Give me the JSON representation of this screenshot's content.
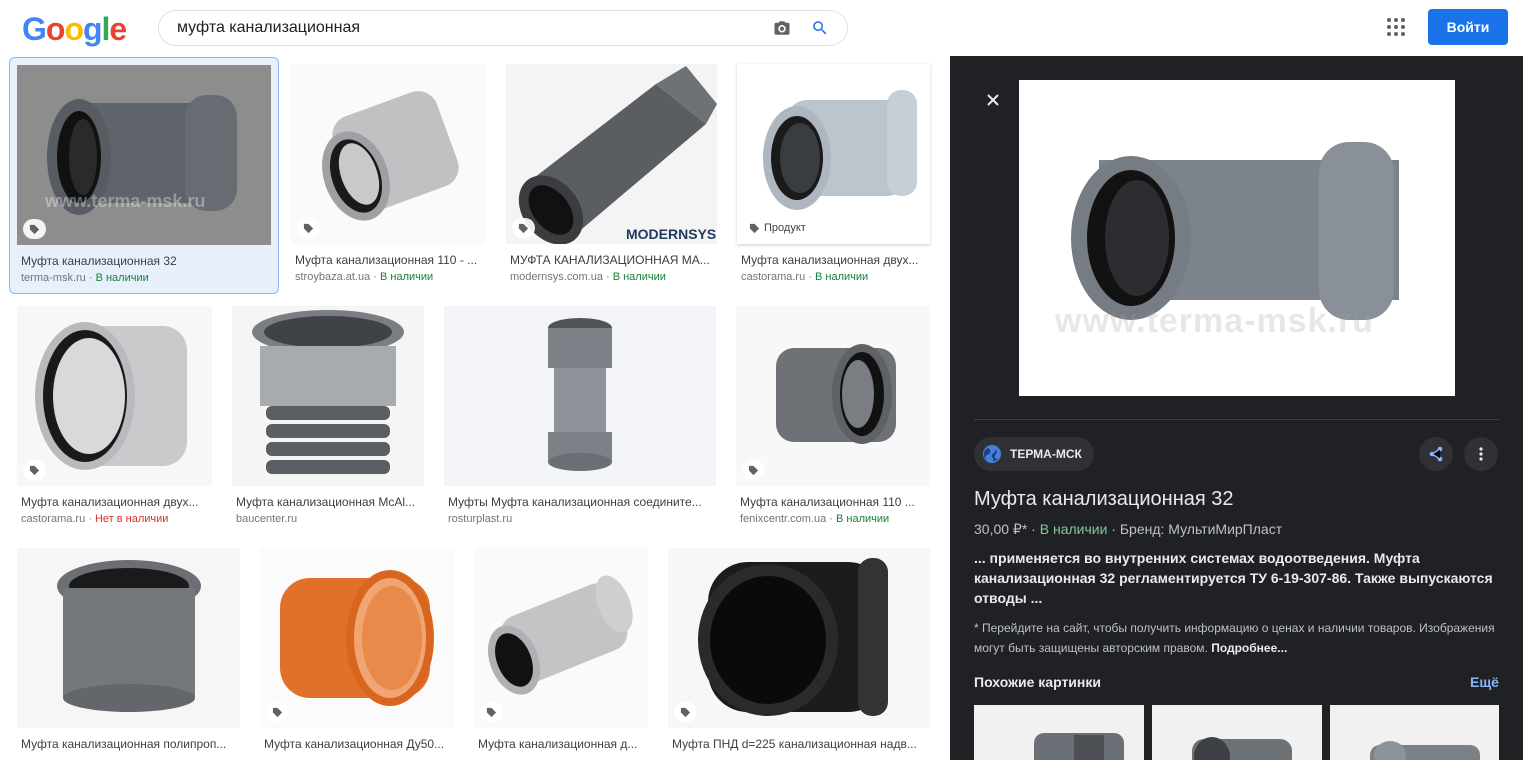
{
  "header": {
    "search_value": "муфта канализационная",
    "signin_label": "Войти"
  },
  "results": [
    {
      "title": "Муфта канализационная 32",
      "source": "terma-msk.ru",
      "status": "В наличии",
      "status_type": "available",
      "tag": "",
      "watermark": "www.terma-msk.ru"
    },
    {
      "title": "Муфта канализационная 110 - ...",
      "source": "stroybaza.at.ua",
      "status": "В наличии",
      "status_type": "available",
      "tag": ""
    },
    {
      "title": "МУФТА КАНАЛИЗАЦИОННАЯ МА...",
      "source": "modernsys.com.ua",
      "status": "В наличии",
      "status_type": "available",
      "tag": "",
      "watermark": "MODERNSYS"
    },
    {
      "title": "Муфта канализационная двух...",
      "source": "castorama.ru",
      "status": "В наличии",
      "status_type": "available",
      "tag": "Продукт"
    },
    {
      "title": "Муфта канализационная двух...",
      "source": "castorama.ru",
      "status": "Нет в наличии",
      "status_type": "unavailable",
      "tag": ""
    },
    {
      "title": "Муфта канализационная McAl...",
      "source": "baucenter.ru",
      "status": "",
      "status_type": "none",
      "tag": ""
    },
    {
      "title": "Муфты Муфта канализационная соедините...",
      "source": "rosturplast.ru",
      "status": "",
      "status_type": "none",
      "tag": ""
    },
    {
      "title": "Муфта канализационная 110 ...",
      "source": "fenixcentr.com.ua",
      "status": "В наличии",
      "status_type": "available",
      "tag": ""
    },
    {
      "title": "Муфта канализационная полипроп...",
      "source": "",
      "status": "",
      "status_type": "none",
      "tag": ""
    },
    {
      "title": "Муфта канализационная Ду50...",
      "source": "",
      "status": "",
      "status_type": "none",
      "tag": ""
    },
    {
      "title": "Муфта канализационная д...",
      "source": "",
      "status": "",
      "status_type": "none",
      "tag": ""
    },
    {
      "title": "Муфта ПНД d=225 канализационная надв...",
      "source": "",
      "status": "",
      "status_type": "none",
      "tag": ""
    }
  ],
  "panel": {
    "site_name": "ТЕРМА-МСК",
    "title": "Муфта канализационная 32",
    "price": "30,00 ₽*",
    "availability": "В наличии",
    "brand": "Бренд: МультиМирПласт",
    "description": "... применяется во внутренних системах водоотведения. Муфта канализационная 32 регламентируется ТУ 6-19-307-86. Также выпускаются отводы ...",
    "note": "* Перейдите на сайт, чтобы получить информацию о ценах и наличии товаров. Изображения могут быть защищены авторским правом.",
    "note_more": "Подробнее...",
    "similar_heading": "Похожие картинки",
    "more_label": "Ещё",
    "watermark": "www.terma-msk.ru"
  },
  "colors": {
    "brand_blue": "#1a73e8",
    "available_green": "#188038",
    "unavailable_red": "#d93025",
    "panel_bg": "#202124"
  }
}
